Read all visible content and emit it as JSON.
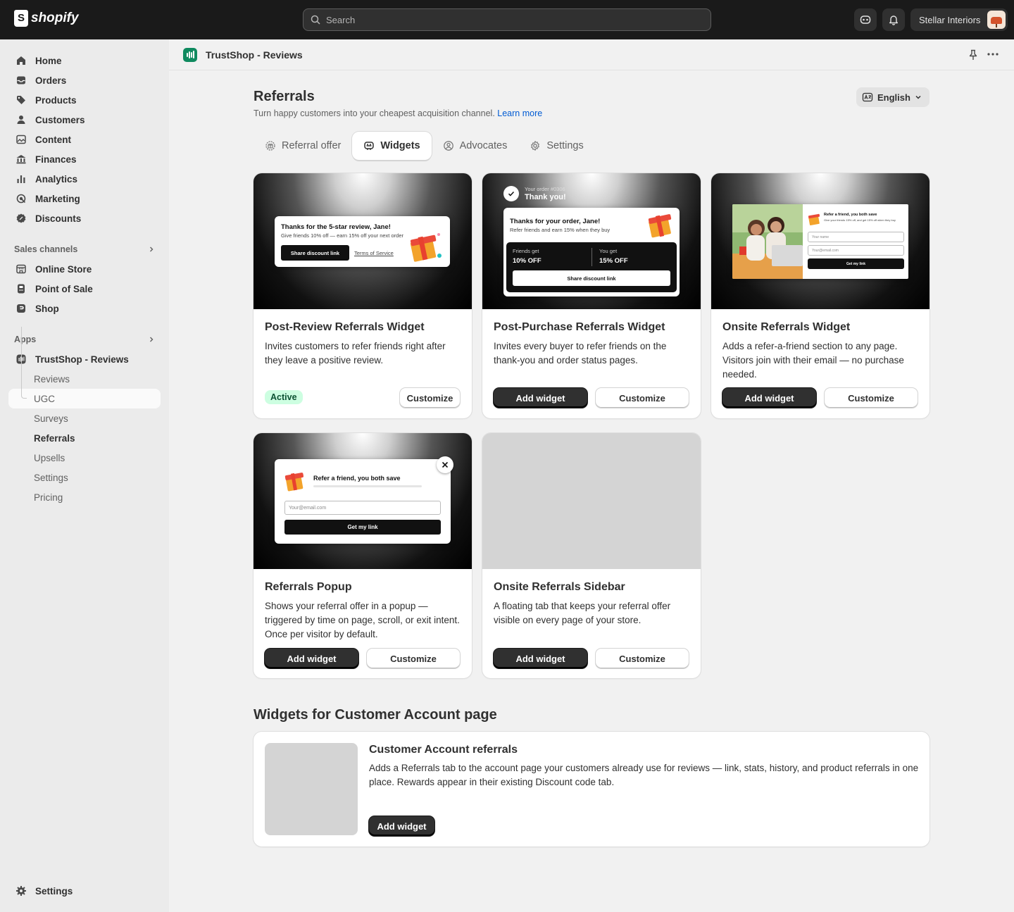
{
  "topbar": {
    "brand": "shopify",
    "search_placeholder": "Search",
    "store_name": "Stellar Interiors"
  },
  "sidebar": {
    "main": [
      {
        "label": "Home",
        "icon": "home-icon"
      },
      {
        "label": "Orders",
        "icon": "inbox-icon"
      },
      {
        "label": "Products",
        "icon": "tag-icon"
      },
      {
        "label": "Customers",
        "icon": "person-icon"
      },
      {
        "label": "Content",
        "icon": "image-icon"
      },
      {
        "label": "Finances",
        "icon": "bank-icon"
      },
      {
        "label": "Analytics",
        "icon": "bar-chart-icon"
      },
      {
        "label": "Marketing",
        "icon": "target-icon"
      },
      {
        "label": "Discounts",
        "icon": "discount-icon"
      }
    ],
    "sales_channels_label": "Sales channels",
    "sales_channels": [
      {
        "label": "Online Store",
        "icon": "store-icon"
      },
      {
        "label": "Point of Sale",
        "icon": "pos-icon"
      },
      {
        "label": "Shop",
        "icon": "shop-icon"
      }
    ],
    "apps_label": "Apps",
    "app_name": "TrustShop - Reviews",
    "app_subitems": [
      "Reviews",
      "UGC",
      "Surveys",
      "Referrals",
      "Upsells",
      "Settings",
      "Pricing"
    ],
    "active_subitem": "Referrals",
    "settings_label": "Settings"
  },
  "appbar": {
    "title": "TrustShop - Reviews"
  },
  "page": {
    "title": "Referrals",
    "subtitle": "Turn happy customers into your cheapest acquisition channel.",
    "learn_more": "Learn more",
    "language": "English"
  },
  "tabs": [
    {
      "label": "Referral offer",
      "icon": "gift-icon",
      "active": false
    },
    {
      "label": "Widgets",
      "icon": "widget-icon",
      "active": true
    },
    {
      "label": "Advocates",
      "icon": "person-circle-icon",
      "active": false
    },
    {
      "label": "Settings",
      "icon": "gear-icon",
      "active": false
    }
  ],
  "widgets": [
    {
      "title": "Post-Review Referrals Widget",
      "description": "Invites customers to refer friends right after they leave a positive review.",
      "status": "Active",
      "customize_label": "Customize",
      "preview": {
        "heading": "Thanks for the 5-star review, Jane!",
        "text": "Give friends 10% off — earn 15% off your next order",
        "button": "Share discount link",
        "link": "Terms of Service"
      }
    },
    {
      "title": "Post-Purchase Referrals Widget",
      "description": "Invites every buyer to refer friends on the thank-you and order status pages.",
      "add_label": "Add widget",
      "customize_label": "Customize",
      "preview": {
        "order": "Your order #0306",
        "thanks": "Thank you!",
        "heading": "Thanks for your order, Jane!",
        "text": "Refer friends and earn 15% when they buy",
        "friends_label": "Friends get",
        "friends_value": "10% OFF",
        "you_label": "You get",
        "you_value": "15% OFF",
        "button": "Share discount link"
      }
    },
    {
      "title": "Onsite Referrals Widget",
      "description": "Adds a refer-a-friend section to any page. Visitors join with their email — no purchase needed.",
      "add_label": "Add widget",
      "customize_label": "Customize",
      "preview": {
        "heading": "Refer a friend, you both save",
        "text": "Give your friends 15% off, and get 15% off when they buy",
        "name_placeholder": "Your name",
        "email_placeholder": "Your@email.com",
        "button": "Get my link"
      }
    },
    {
      "title": "Referrals Popup",
      "description": "Shows your referral offer in a popup — triggered by time on page, scroll, or exit intent. Once per visitor by default.",
      "add_label": "Add widget",
      "customize_label": "Customize",
      "preview": {
        "heading": "Refer a friend, you both save",
        "email_placeholder": "Your@email.com",
        "button": "Get my link"
      }
    },
    {
      "title": "Onsite Referrals Sidebar",
      "description": "A floating tab that keeps your referral offer visible on every page of your store.",
      "add_label": "Add widget",
      "customize_label": "Customize"
    }
  ],
  "account_section": {
    "title": "Widgets for Customer Account page",
    "card_title": "Customer Account referrals",
    "card_desc": "Adds a Referrals tab to the account page your customers already use for reviews — link, stats, history, and product referrals in one place. Rewards appear in their existing Discount code tab.",
    "add_label": "Add widget"
  },
  "colors": {
    "accent_link": "#005bd3",
    "active_badge_bg": "#cdfee1",
    "active_badge_text": "#0c5132",
    "app_logo": "#0f8a5f"
  }
}
